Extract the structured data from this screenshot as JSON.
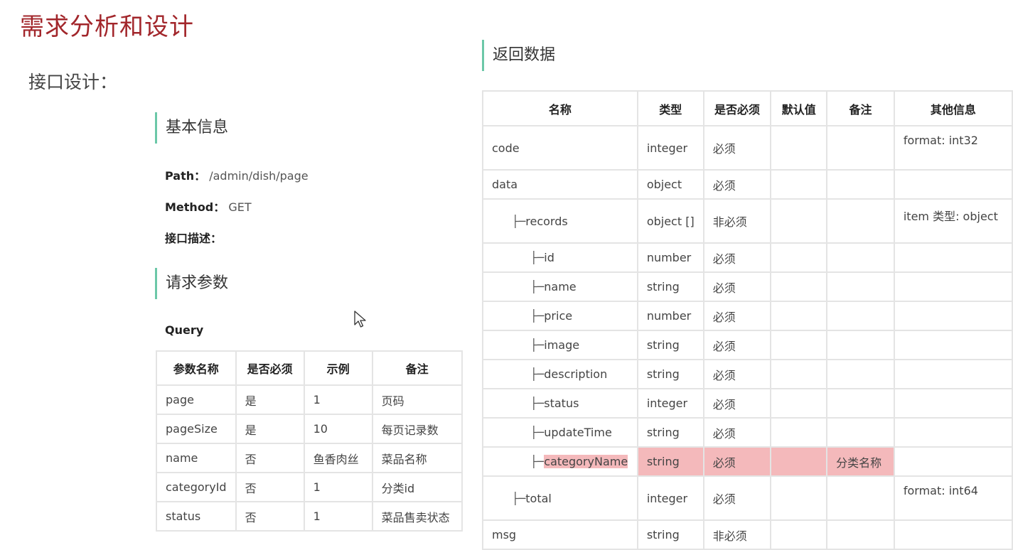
{
  "header": {
    "title": "需求分析和设计",
    "subtitle": "接口设计："
  },
  "basic": {
    "section_title": "基本信息",
    "path_label": "Path：",
    "path_value": "/admin/dish/page",
    "method_label": "Method：",
    "method_value": "GET",
    "desc_label": "接口描述："
  },
  "request": {
    "section_title": "请求参数",
    "query_label": "Query",
    "headers": [
      "参数名称",
      "是否必须",
      "示例",
      "备注"
    ],
    "rows": [
      [
        "page",
        "是",
        "1",
        "页码"
      ],
      [
        "pageSize",
        "是",
        "10",
        "每页记录数"
      ],
      [
        "name",
        "否",
        "鱼香肉丝",
        "菜品名称"
      ],
      [
        "categoryId",
        "否",
        "1",
        "分类id"
      ],
      [
        "status",
        "否",
        "1",
        "菜品售卖状态"
      ]
    ]
  },
  "response": {
    "section_title": "返回数据",
    "headers": [
      "名称",
      "类型",
      "是否必须",
      "默认值",
      "备注",
      "其他信息"
    ],
    "rows": [
      {
        "prefix": "",
        "name": "code",
        "type": "integer",
        "required": "必须",
        "default": "",
        "note": "",
        "other": "format: int32"
      },
      {
        "prefix": "",
        "name": "data",
        "type": "object",
        "required": "必须",
        "default": "",
        "note": "",
        "other": ""
      },
      {
        "prefix": "├─",
        "name": "records",
        "type": "object []",
        "required": "非必须",
        "default": "",
        "note": "",
        "other": "item 类型: object"
      },
      {
        "prefix": "├─",
        "name": "id",
        "type": "number",
        "required": "必须",
        "default": "",
        "note": "",
        "other": ""
      },
      {
        "prefix": "├─",
        "name": "name",
        "type": "string",
        "required": "必须",
        "default": "",
        "note": "",
        "other": ""
      },
      {
        "prefix": "├─",
        "name": "price",
        "type": "number",
        "required": "必须",
        "default": "",
        "note": "",
        "other": ""
      },
      {
        "prefix": "├─",
        "name": "image",
        "type": "string",
        "required": "必须",
        "default": "",
        "note": "",
        "other": ""
      },
      {
        "prefix": "├─",
        "name": "description",
        "type": "string",
        "required": "必须",
        "default": "",
        "note": "",
        "other": ""
      },
      {
        "prefix": "├─",
        "name": "status",
        "type": "integer",
        "required": "必须",
        "default": "",
        "note": "",
        "other": ""
      },
      {
        "prefix": "├─",
        "name": "updateTime",
        "type": "string",
        "required": "必须",
        "default": "",
        "note": "",
        "other": ""
      },
      {
        "prefix": "├─",
        "name": "categoryName",
        "type": "string",
        "required": "必须",
        "default": "",
        "note": "分类名称",
        "other": ""
      },
      {
        "prefix": "├─",
        "name": "total",
        "type": "integer",
        "required": "必须",
        "default": "",
        "note": "",
        "other": "format: int64"
      },
      {
        "prefix": "",
        "name": "msg",
        "type": "string",
        "required": "非必须",
        "default": "",
        "note": "",
        "other": ""
      }
    ]
  },
  "colors": {
    "title": "#a2262b",
    "section_bar": "#6cc8a8",
    "highlight": "#f4b9bb"
  },
  "icons": {
    "cursor": "mouse-pointer-icon"
  }
}
